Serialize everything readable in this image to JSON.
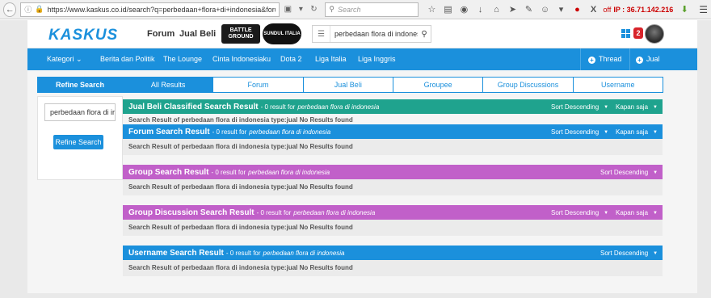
{
  "browser": {
    "url": "https://www.kaskus.co.id/search?q=perbedaan+flora+di+indonesia&forumchoic",
    "search_placeholder": "Search",
    "ip_off": "off",
    "ip_text": "IP : 36.71.142.216"
  },
  "header": {
    "logo": "KASKUS",
    "nav": [
      "Forum",
      "Jual Beli"
    ],
    "badge_battleground": "BATTLE GROUND",
    "badge_sundul": "SUNDUL ITALIA",
    "search_value": "perbedaan flora di indonesia",
    "notification_count": "2"
  },
  "bluenav": {
    "kategori": "Kategori",
    "items": [
      "Berita dan Politik",
      "The Lounge",
      "Cinta Indonesiaku",
      "Dota 2",
      "Liga Italia",
      "Liga Inggris"
    ],
    "thread": "Thread",
    "jual": "Jual"
  },
  "refine": {
    "title": "Refine Search",
    "input_value": "perbedaan flora di ir",
    "button": "Refine Search"
  },
  "tabs": [
    "All Results",
    "Forum",
    "Jual Beli",
    "Groupee",
    "Group Discussions",
    "Username"
  ],
  "sections": [
    {
      "title": "Jual Beli Classified Search Result",
      "count": "- 0 result for",
      "query": "perbedaan flora di indonesia",
      "sort": "Sort Descending",
      "time": "Kapan saja",
      "body": "Search Result of perbedaan flora di indonesia type:jual No Results found"
    },
    {
      "title": "Forum Search Result",
      "count": "- 0 result for",
      "query": "perbedaan flora di indonesia",
      "sort": "Sort Descending",
      "time": "Kapan saja",
      "body": "Search Result of perbedaan flora di indonesia type:jual No Results found"
    },
    {
      "title": "Group Search Result",
      "count": "- 0 result for",
      "query": "perbedaan flora di indonesia",
      "sort": "Sort Descending",
      "time": "",
      "body": "Search Result of perbedaan flora di indonesia type:jual No Results found"
    },
    {
      "title": "Group Discussion Search Result",
      "count": "- 0 result for",
      "query": "perbedaan flora di indonesia",
      "sort": "Sort Descending",
      "time": "Kapan saja",
      "body": "Search Result of perbedaan flora di indonesia type:jual No Results found"
    },
    {
      "title": "Username Search Result",
      "count": "- 0 result for",
      "query": "perbedaan flora di indonesia",
      "sort": "Sort Descending",
      "time": "",
      "body": "Search Result of perbedaan flora di indonesia type:jual No Results found"
    }
  ],
  "colors": {
    "kaskus_blue": "#1b90dc",
    "green": "#1fa38e",
    "purple": "#c160c9"
  }
}
